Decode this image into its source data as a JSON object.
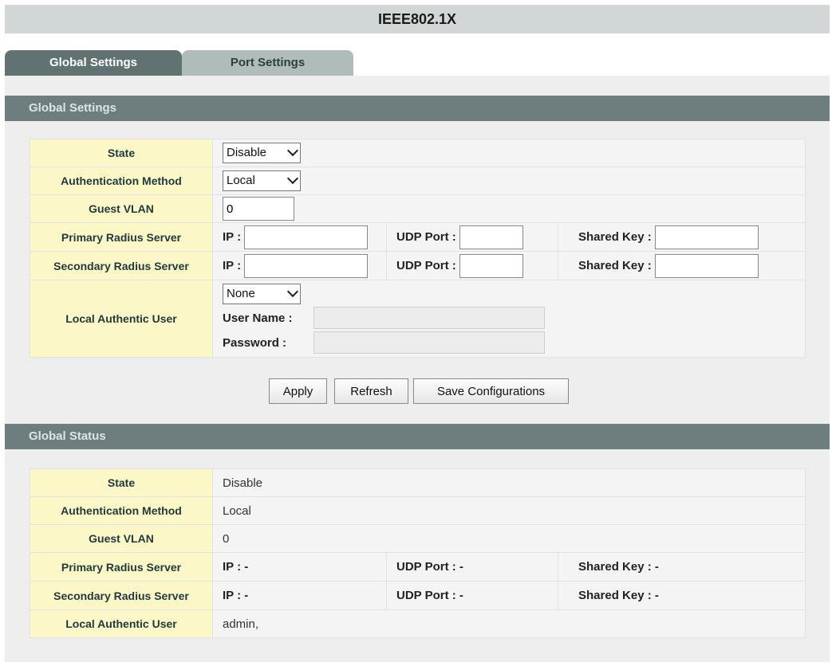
{
  "header": {
    "title": "IEEE802.1X"
  },
  "tabs": [
    {
      "label": "Global Settings"
    },
    {
      "label": "Port Settings"
    }
  ],
  "settings": {
    "section_title": "Global Settings",
    "state": {
      "label": "State",
      "value": "Disable"
    },
    "auth_method": {
      "label": "Authentication Method",
      "value": "Local"
    },
    "guest_vlan": {
      "label": "Guest VLAN",
      "value": "0"
    },
    "primary_radius": {
      "label": "Primary Radius Server",
      "ip_label": "IP :",
      "udp_label": "UDP Port :",
      "key_label": "Shared Key :"
    },
    "secondary_radius": {
      "label": "Secondary Radius Server",
      "ip_label": "IP :",
      "udp_label": "UDP Port :",
      "key_label": "Shared Key :"
    },
    "local_user": {
      "label": "Local Authentic User",
      "select_value": "None",
      "username_label": "User Name :",
      "password_label": "Password :"
    }
  },
  "buttons": {
    "apply": "Apply",
    "refresh": "Refresh",
    "save": "Save Configurations"
  },
  "status": {
    "section_title": "Global Status",
    "state": {
      "label": "State",
      "value": "Disable"
    },
    "auth_method": {
      "label": "Authentication Method",
      "value": "Local"
    },
    "guest_vlan": {
      "label": "Guest VLAN",
      "value": "0"
    },
    "primary_radius": {
      "label": "Primary Radius Server",
      "ip": "IP : -",
      "udp": "UDP Port : -",
      "key": "Shared Key : -"
    },
    "secondary_radius": {
      "label": "Secondary Radius Server",
      "ip": "IP : -",
      "udp": "UDP Port : -",
      "key": "Shared Key : -"
    },
    "local_user": {
      "label": "Local Authentic User",
      "value": "admin,"
    }
  }
}
